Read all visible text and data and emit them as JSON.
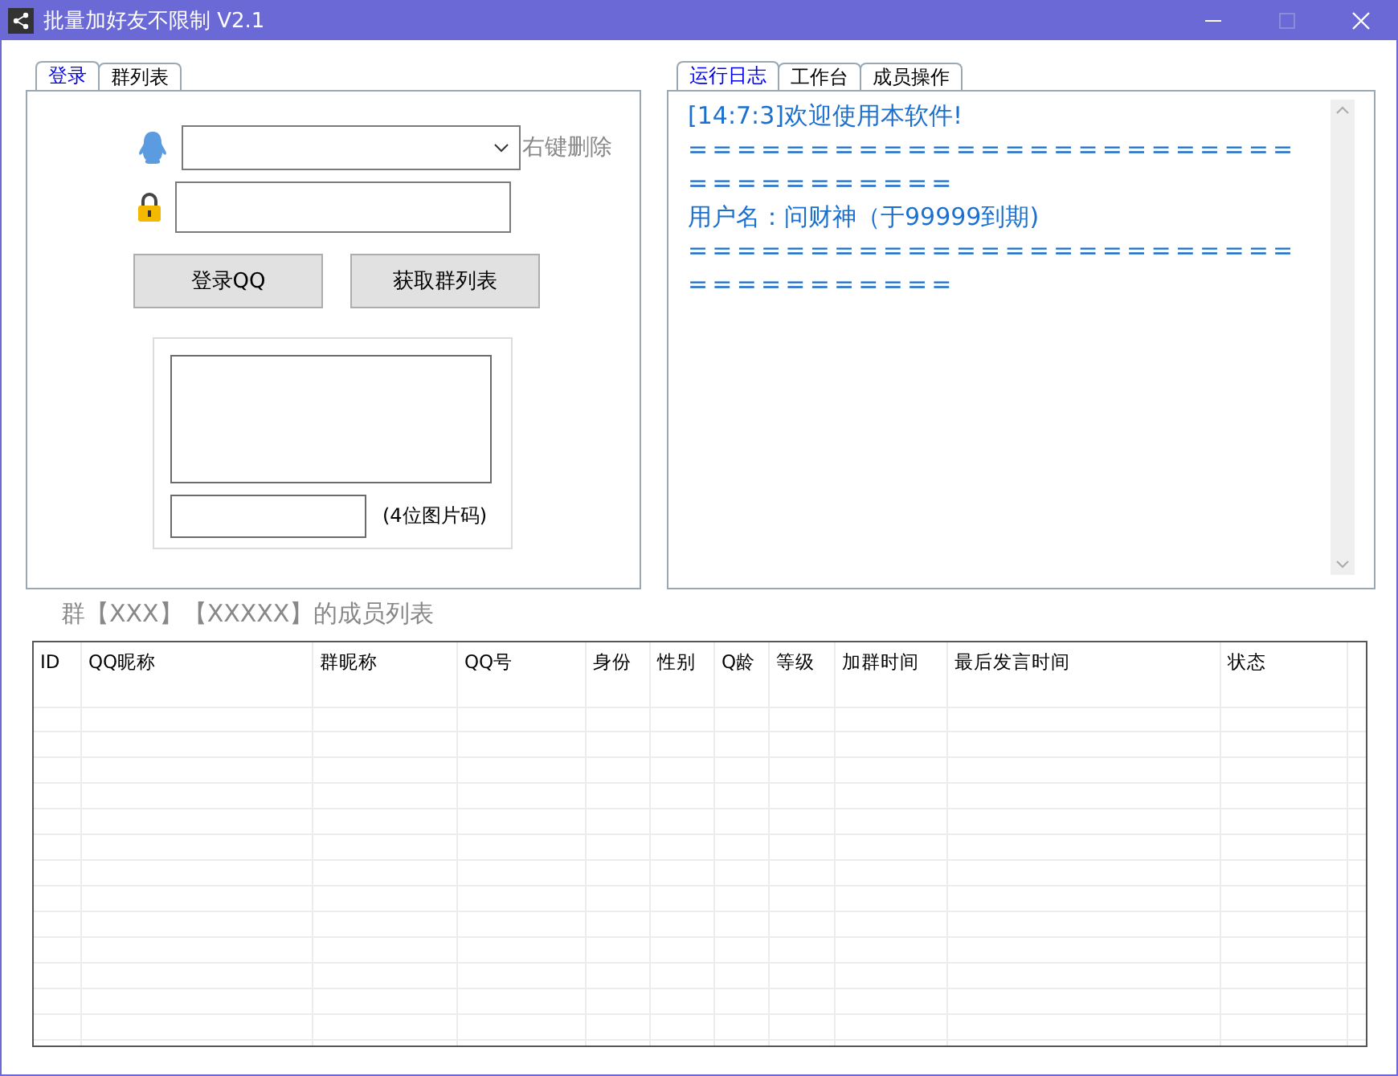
{
  "window": {
    "title": "批量加好友不限制 V2.1",
    "controls": [
      {
        "kind": "minimize",
        "disabled": false
      },
      {
        "kind": "maximize",
        "disabled": true
      },
      {
        "kind": "close",
        "disabled": false
      }
    ]
  },
  "login_panel": {
    "tabs": [
      {
        "label": "登录",
        "selected": true
      },
      {
        "label": "群列表",
        "selected": false
      }
    ],
    "account_hint": "右键删除",
    "buttons": [
      "登录QQ",
      "获取群列表"
    ],
    "captcha_hint": "(4位图片码)"
  },
  "log_panel": {
    "tabs": [
      {
        "label": "运行日志",
        "selected": true
      },
      {
        "label": "工作台",
        "selected": false
      },
      {
        "label": "成员操作",
        "selected": false
      }
    ],
    "lines": [
      "[14:7:3]欢迎使用本软件!",
      "====================================",
      "用户名：问财神（于99999到期)",
      "===================================="
    ]
  },
  "member_list": {
    "title": "群【XXX】【XXXXX】的成员列表",
    "columns": [
      "ID",
      "QQ昵称",
      "群昵称",
      "QQ号",
      "身份",
      "性别",
      "Q龄",
      "等级",
      "加群时间",
      "最后发言时间",
      "状态"
    ]
  }
}
